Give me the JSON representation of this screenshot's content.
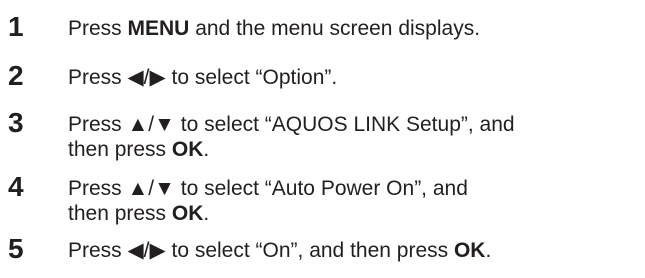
{
  "steps": [
    {
      "number": "1",
      "text_1": "Press ",
      "key": "MENU",
      "text_2": " and the menu screen displays."
    },
    {
      "number": "2",
      "text": "Press ◀/▶ to select “Option”."
    },
    {
      "number": "3",
      "line1": "Press ▲/▼ to select “AQUOS LINK Setup”, and",
      "line2_prefix": "then press ",
      "key": "OK",
      "line2_suffix": "."
    },
    {
      "number": "4",
      "line1": "Press ▲/▼ to select “Auto Power On”, and",
      "line2_prefix": "then press ",
      "key": "OK",
      "line2_suffix": "."
    },
    {
      "number": "5",
      "text_1": "Press ◀/▶ to select “On”, and then press ",
      "key": "OK",
      "text_2": "."
    }
  ]
}
